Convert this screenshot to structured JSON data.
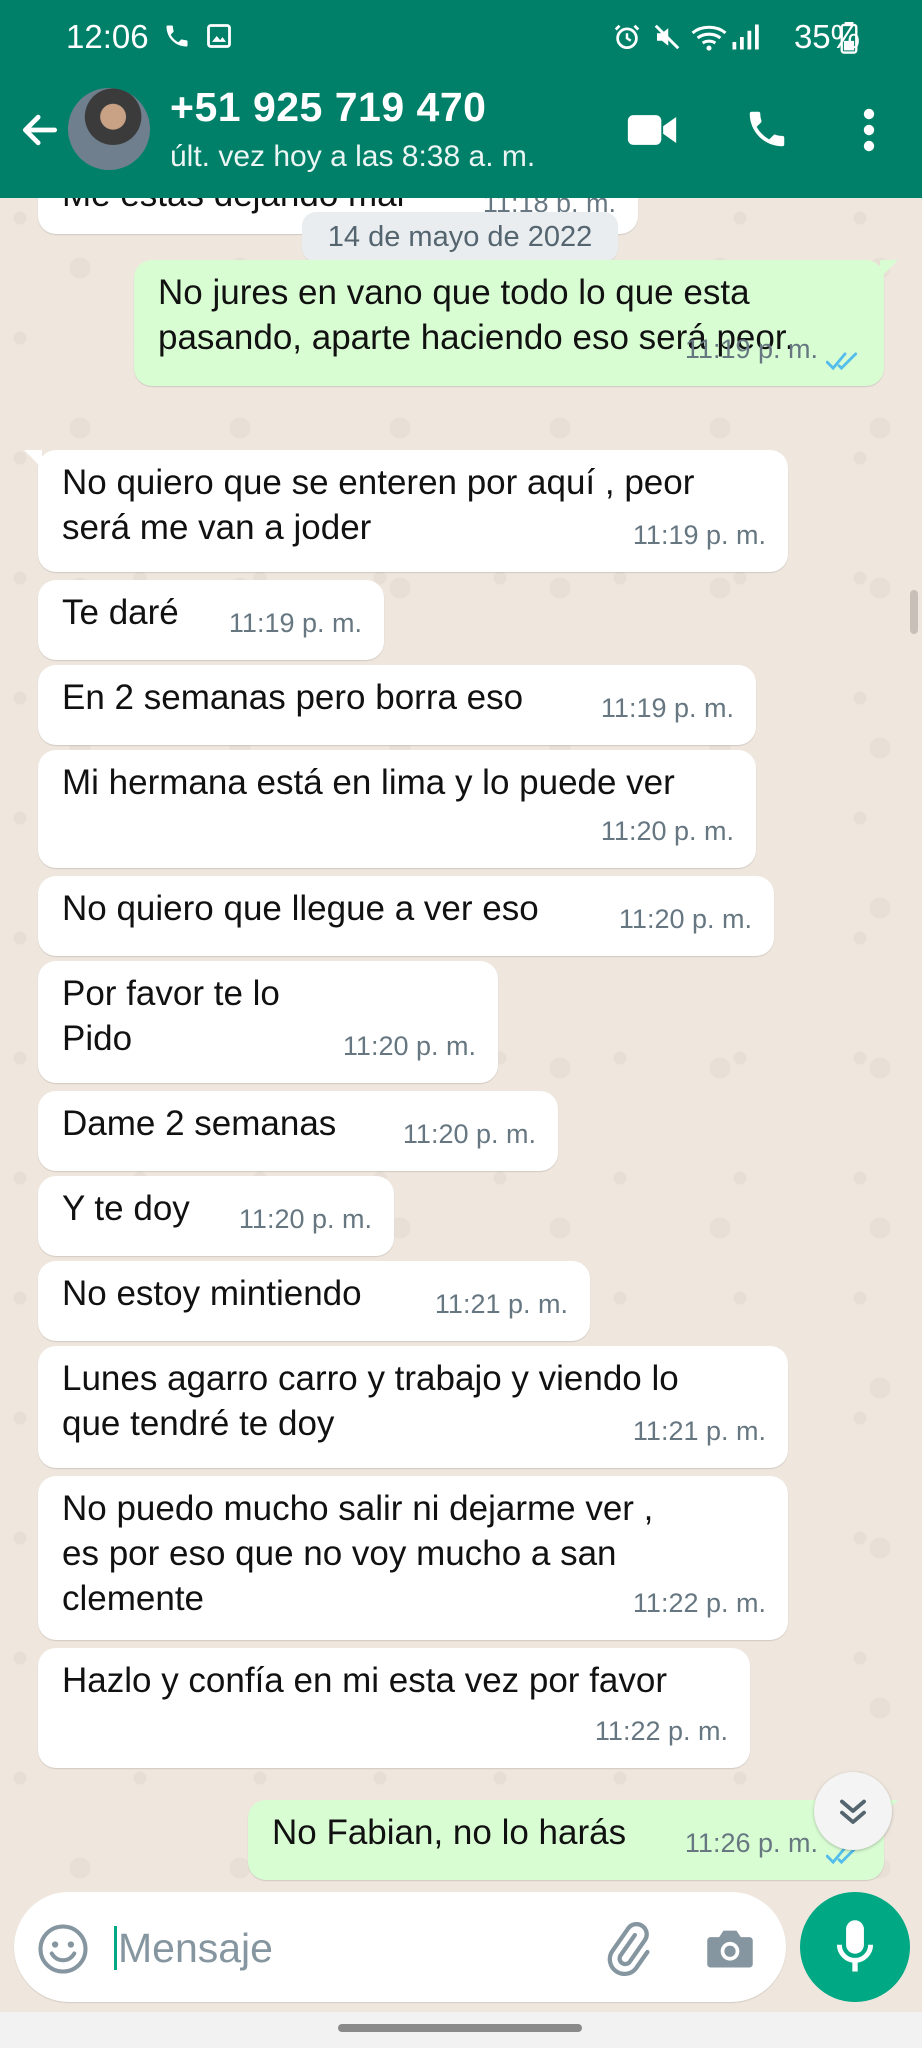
{
  "status_bar": {
    "time": "12:06",
    "battery": "35%",
    "icons": [
      "phone-icon",
      "gallery-icon",
      "alarm-icon",
      "mute-icon",
      "wifi-icon",
      "signal-icon",
      "battery-icon"
    ]
  },
  "header": {
    "contact_name": "+51 925 719 470",
    "last_seen": "últ. vez hoy a las 8:38 a. m.",
    "icons": [
      "back-arrow-icon",
      "video-call-icon",
      "voice-call-icon",
      "more-options-icon"
    ],
    "accent_color": "#008069"
  },
  "chat": {
    "partial_message": {
      "text": "Me estás dejando mal",
      "time": "11:18 p. m."
    },
    "date_chip": "14 de mayo de 2022",
    "messages": [
      {
        "direction": "out",
        "text": "No jures en vano que todo lo que esta\npasando, aparte haciendo eso será peor.",
        "time": "11:19 p. m.",
        "status": "read"
      },
      {
        "direction": "in",
        "text": "No quiero que se enteren por aquí , peor\nserá me van a joder",
        "time": "11:19 p. m."
      },
      {
        "direction": "in",
        "text": "Te daré",
        "time": "11:19 p. m."
      },
      {
        "direction": "in",
        "text": "En 2 semanas pero borra eso",
        "time": "11:19 p. m."
      },
      {
        "direction": "in",
        "text": "Mi hermana está en lima y lo puede ver",
        "time": "11:20 p. m."
      },
      {
        "direction": "in",
        "text": "No quiero que llegue a ver eso",
        "time": "11:20 p. m."
      },
      {
        "direction": "in",
        "text": "Por favor te lo\nPido",
        "time": "11:20 p. m."
      },
      {
        "direction": "in",
        "text": "Dame 2 semanas",
        "time": "11:20 p. m."
      },
      {
        "direction": "in",
        "text": "Y te doy",
        "time": "11:20 p. m."
      },
      {
        "direction": "in",
        "text": "No estoy mintiendo",
        "time": "11:21 p. m."
      },
      {
        "direction": "in",
        "text": "Lunes agarro carro y trabajo y viendo lo\nque tendré te doy",
        "time": "11:21 p. m."
      },
      {
        "direction": "in",
        "text": "No puedo mucho salir ni dejarme ver ,\nes por eso que no voy mucho a san\nclemente",
        "time": "11:22 p. m."
      },
      {
        "direction": "in",
        "text": "Hazlo y confía en mi esta vez por favor",
        "time": "11:22 p. m."
      },
      {
        "direction": "out",
        "text": "No Fabian, no lo harás",
        "time": "11:26 p. m.",
        "status": "read"
      }
    ],
    "colors": {
      "incoming": "#ffffff",
      "outgoing": "#d9fdd3",
      "read_ticks": "#53bdeb",
      "background": "#efe7de"
    }
  },
  "input": {
    "placeholder": "Mensaje",
    "icons": [
      "emoji-icon",
      "attach-icon",
      "camera-icon",
      "mic-icon"
    ],
    "mic_color": "#00a884"
  }
}
